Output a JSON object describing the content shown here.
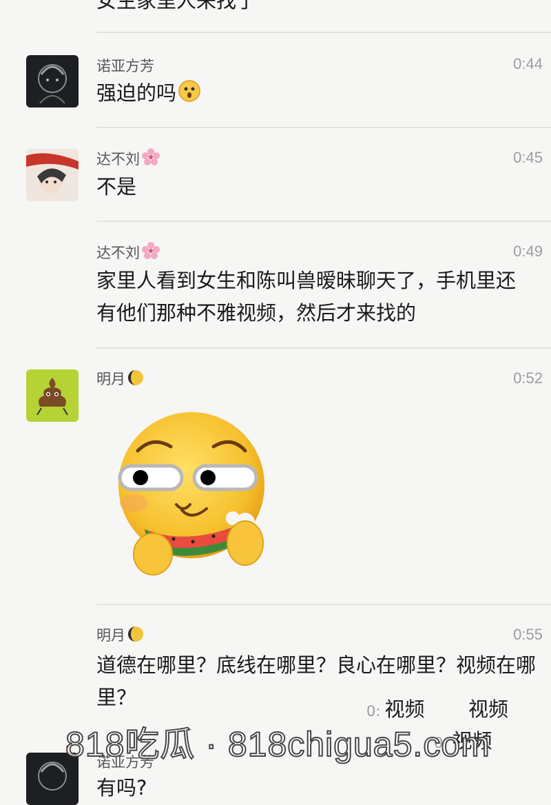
{
  "top_fragment": "女生家里人来找了",
  "messages": [
    {
      "name": "诺亚方芳",
      "time": "0:44",
      "text": "强迫的吗"
    },
    {
      "name": "达不刘",
      "time": "0:45",
      "text": "不是"
    },
    {
      "name": "达不刘",
      "time": "0:49",
      "text": "家里人看到女生和陈叫兽暧昧聊天了，手机里还有他们那种不雅视频，然后才来找的"
    },
    {
      "name": "明月",
      "time": "0:52",
      "sticker": "watermelon-eating-emoji-sticker"
    },
    {
      "name": "明月",
      "time": "0:55",
      "text": "道德在哪里？底线在哪里？良心在哪里？视频在哪里？"
    },
    {
      "name": "诺亚方芳",
      "text": "有吗?"
    }
  ],
  "overlay": {
    "prefix1": "0:",
    "word1": "视频",
    "word2": "视频",
    "prefix2": "0:",
    "word3": "视频"
  },
  "watermark": "818吃瓜 · 818chigua5.com",
  "colors": {
    "background": "#f6f6f4",
    "time": "#9d9d9d",
    "avatar_lime": "#b5d334"
  }
}
